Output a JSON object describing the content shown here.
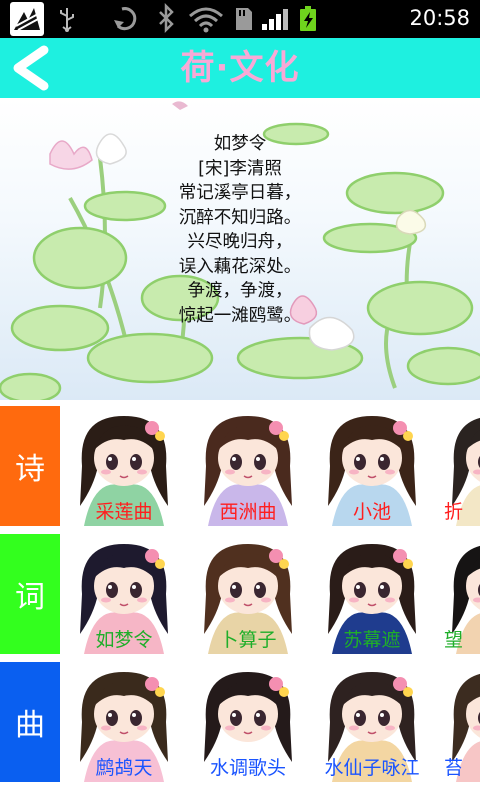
{
  "status_bar": {
    "time": "20:58"
  },
  "title_bar": {
    "title": "荷·文化"
  },
  "poem": {
    "lines": [
      "如梦令",
      "[宋]李清照",
      "常记溪亭日暮，",
      "沉醉不知归路。",
      "兴尽晚归舟，",
      "误入藕花深处。",
      "争渡，争渡，",
      "惊起一滩鸥鹭。"
    ]
  },
  "categories": [
    {
      "label": "诗",
      "color": "#ff6a0e",
      "label_color": "#ff1e1e",
      "items": [
        "采莲曲",
        "西洲曲",
        "小池",
        "折"
      ]
    },
    {
      "label": "词",
      "color": "#33ff1e",
      "label_color": "#1fae2a",
      "items": [
        "如梦令",
        "卜算子",
        "苏幕遮",
        "望"
      ]
    },
    {
      "label": "曲",
      "color": "#0a5ff0",
      "label_color": "#1a54ff",
      "items": [
        "鹧鸪天",
        "水调歌头",
        "水仙子咏江",
        "苔"
      ]
    }
  ],
  "icons": {
    "back": "chevron-left-icon",
    "status": [
      "app-icon",
      "usb-icon",
      "sync-icon",
      "bluetooth-icon",
      "wifi-icon",
      "sd-card-icon",
      "signal-icon",
      "battery-charging-icon"
    ]
  }
}
